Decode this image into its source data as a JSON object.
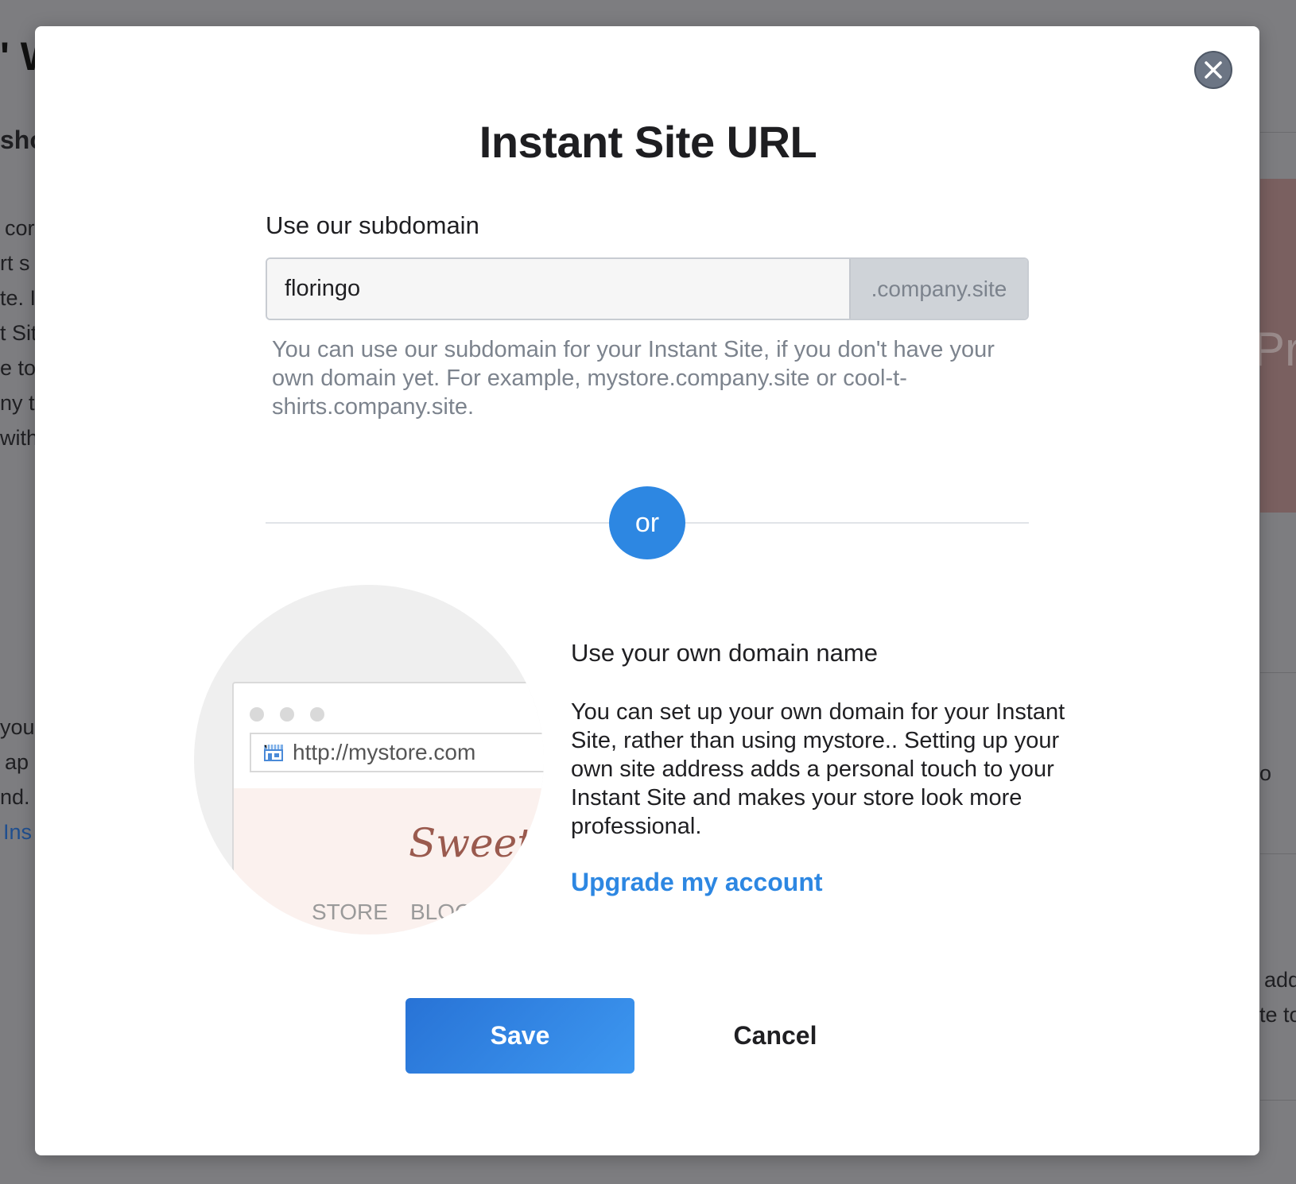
{
  "background": {
    "fragments": [
      "' W",
      "sho",
      "cor",
      "rt s",
      "te. I",
      "t Sit",
      "e to",
      "ny t",
      "with",
      "you",
      "ap",
      "nd. I",
      "Ins",
      "Pr",
      "o",
      "add",
      "te to"
    ]
  },
  "modal": {
    "title": "Instant Site URL",
    "subdomain_label": "Use our subdomain",
    "subdomain_value": "floringo",
    "subdomain_suffix": ".company.site",
    "subdomain_help": "You can use our subdomain for your Instant Site, if you don't have your own domain yet. For example, mystore.company.site or cool-t-shirts.company.site.",
    "or_label": "or",
    "illustration": {
      "url": "http://mystore.com",
      "brand": "Sweet",
      "nav_store": "STORE",
      "nav_blog": "BLOG"
    },
    "own_domain_title": "Use your own domain name",
    "own_domain_desc": "You can set up your own domain for your Instant Site, rather than using mystore.. Setting up your own site address adds a personal touch to your Instant Site and makes your store look more professional.",
    "upgrade_link": "Upgrade my account",
    "save_label": "Save",
    "cancel_label": "Cancel"
  },
  "colors": {
    "accent": "#2d87e2",
    "overlay": "#7d7d80",
    "close_button": "#6c7584",
    "help_text": "#7c838d"
  },
  "icons": {
    "close": "close-icon",
    "store": "store-icon"
  }
}
